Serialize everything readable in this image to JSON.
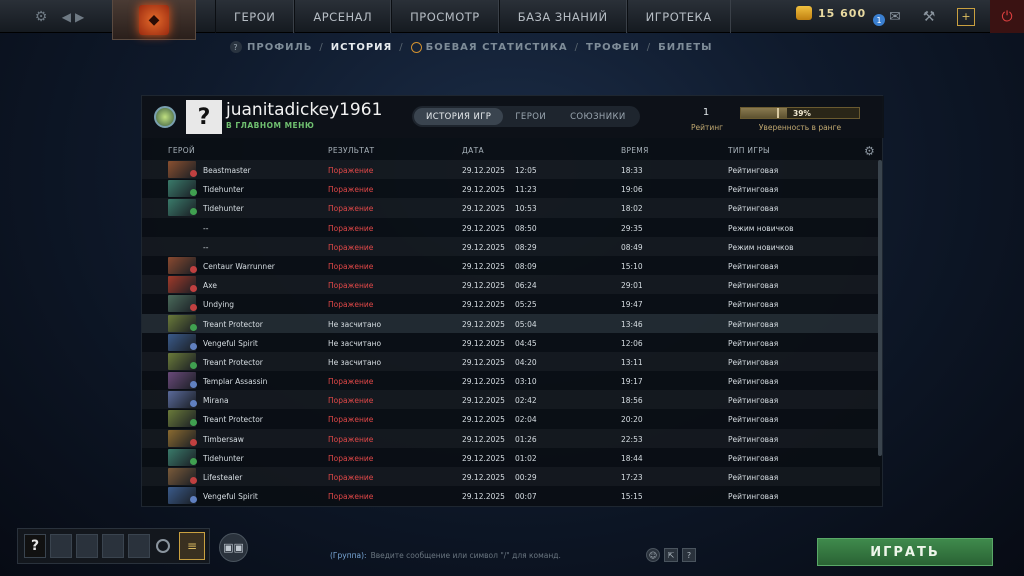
{
  "topbar": {
    "nav": [
      "ГЕРОИ",
      "АРСЕНАЛ",
      "ПРОСМОТР",
      "БАЗА ЗНАНИЙ",
      "ИГРОТЕКА"
    ],
    "currency": "15 600",
    "notification_count": "1"
  },
  "subnav": {
    "items": [
      "ПРОФИЛЬ",
      "ИСТОРИЯ",
      "БОЕВАЯ СТАТИСТИКА",
      "ТРОФЕИ",
      "БИЛЕТЫ"
    ],
    "active": "ИСТОРИЯ"
  },
  "profile": {
    "avatar_glyph": "?",
    "username": "juanitadickey1961",
    "status": "В ГЛАВНОМ МЕНЮ",
    "tabs": [
      "ИСТОРИЯ ИГР",
      "ГЕРОИ",
      "СОЮЗНИКИ"
    ],
    "active_tab": "ИСТОРИЯ ИГР",
    "rating_value": "1",
    "rating_label": "Рейтинг",
    "confidence_text": "39%",
    "confidence_fraction": 0.39,
    "confidence_label": "Уверенность в ранге"
  },
  "table": {
    "headers": {
      "hero": "ГЕРОЙ",
      "result": "РЕЗУЛЬТАТ",
      "date": "ДАТА",
      "duration": "ВРЕМЯ",
      "type": "ТИП ИГРЫ"
    },
    "rows": [
      {
        "hero": "Beastmaster",
        "result": "Поражение",
        "loss": true,
        "date": "29.12.2025",
        "time": "12:05",
        "duration": "18:33",
        "type": "Рейтинговая",
        "color": "#8a5030",
        "badge": "#c04040"
      },
      {
        "hero": "Tidehunter",
        "result": "Поражение",
        "loss": true,
        "date": "29.12.2025",
        "time": "11:23",
        "duration": "19:06",
        "type": "Рейтинговая",
        "color": "#3a7a6a",
        "badge": "#40a050"
      },
      {
        "hero": "Tidehunter",
        "result": "Поражение",
        "loss": true,
        "date": "29.12.2025",
        "time": "10:53",
        "duration": "18:02",
        "type": "Рейтинговая",
        "color": "#3a7a6a",
        "badge": "#40a050"
      },
      {
        "hero": "--",
        "result": "Поражение",
        "loss": true,
        "date": "29.12.2025",
        "time": "08:50",
        "duration": "29:35",
        "type": "Режим новичков",
        "color": "",
        "badge": ""
      },
      {
        "hero": "--",
        "result": "Поражение",
        "loss": true,
        "date": "29.12.2025",
        "time": "08:29",
        "duration": "08:49",
        "type": "Режим новичков",
        "color": "",
        "badge": ""
      },
      {
        "hero": "Centaur Warrunner",
        "result": "Поражение",
        "loss": true,
        "date": "29.12.2025",
        "time": "08:09",
        "duration": "15:10",
        "type": "Рейтинговая",
        "color": "#8a4a30",
        "badge": "#c04040"
      },
      {
        "hero": "Axe",
        "result": "Поражение",
        "loss": true,
        "date": "29.12.2025",
        "time": "06:24",
        "duration": "29:01",
        "type": "Рейтинговая",
        "color": "#a03a2a",
        "badge": "#c04040"
      },
      {
        "hero": "Undying",
        "result": "Поражение",
        "loss": true,
        "date": "29.12.2025",
        "time": "05:25",
        "duration": "19:47",
        "type": "Рейтинговая",
        "color": "#4a6a5a",
        "badge": "#c04040"
      },
      {
        "hero": "Treant Protector",
        "result": "Не засчитано",
        "loss": false,
        "date": "29.12.2025",
        "time": "05:04",
        "duration": "13:46",
        "type": "Рейтинговая",
        "color": "#6a7a3a",
        "badge": "#40a050"
      },
      {
        "hero": "Vengeful Spirit",
        "result": "Не засчитано",
        "loss": false,
        "date": "29.12.2025",
        "time": "04:45",
        "duration": "12:06",
        "type": "Рейтинговая",
        "color": "#3a5a8a",
        "badge": "#6080c0"
      },
      {
        "hero": "Treant Protector",
        "result": "Не засчитано",
        "loss": false,
        "date": "29.12.2025",
        "time": "04:20",
        "duration": "13:11",
        "type": "Рейтинговая",
        "color": "#6a7a3a",
        "badge": "#40a050"
      },
      {
        "hero": "Templar Assassin",
        "result": "Поражение",
        "loss": true,
        "date": "29.12.2025",
        "time": "03:10",
        "duration": "19:17",
        "type": "Рейтинговая",
        "color": "#6a4a7a",
        "badge": "#6080c0"
      },
      {
        "hero": "Mirana",
        "result": "Поражение",
        "loss": true,
        "date": "29.12.2025",
        "time": "02:42",
        "duration": "18:56",
        "type": "Рейтинговая",
        "color": "#5a6a9a",
        "badge": "#6080c0"
      },
      {
        "hero": "Treant Protector",
        "result": "Поражение",
        "loss": true,
        "date": "29.12.2025",
        "time": "02:04",
        "duration": "20:20",
        "type": "Рейтинговая",
        "color": "#6a7a3a",
        "badge": "#40a050"
      },
      {
        "hero": "Timbersaw",
        "result": "Поражение",
        "loss": true,
        "date": "29.12.2025",
        "time": "01:26",
        "duration": "22:53",
        "type": "Рейтинговая",
        "color": "#8a6a30",
        "badge": "#c04040"
      },
      {
        "hero": "Tidehunter",
        "result": "Поражение",
        "loss": true,
        "date": "29.12.2025",
        "time": "01:02",
        "duration": "18:44",
        "type": "Рейтинговая",
        "color": "#3a7a6a",
        "badge": "#40a050"
      },
      {
        "hero": "Lifestealer",
        "result": "Поражение",
        "loss": true,
        "date": "29.12.2025",
        "time": "00:29",
        "duration": "17:23",
        "type": "Рейтинговая",
        "color": "#7a5a3a",
        "badge": "#c04040"
      },
      {
        "hero": "Vengeful Spirit",
        "result": "Поражение",
        "loss": true,
        "date": "29.12.2025",
        "time": "00:07",
        "duration": "15:15",
        "type": "Рейтинговая",
        "color": "#3a5a8a",
        "badge": "#6080c0"
      }
    ],
    "highlighted_row": 8
  },
  "bottom": {
    "party_glyph": "?",
    "chat_group": "(Группа):",
    "chat_placeholder": "Введите сообщение или символ \"/\" для команд.",
    "play_label": "ИГРАТЬ"
  },
  "icons": [
    "gear-icon",
    "back-icon",
    "forward-icon",
    "dota-logo-icon",
    "coin-icon",
    "mail-icon",
    "wrench-icon",
    "plus-icon",
    "power-icon",
    "settings-icon",
    "friends-icon",
    "emoji-icon",
    "chat-expand-icon",
    "help-icon"
  ]
}
